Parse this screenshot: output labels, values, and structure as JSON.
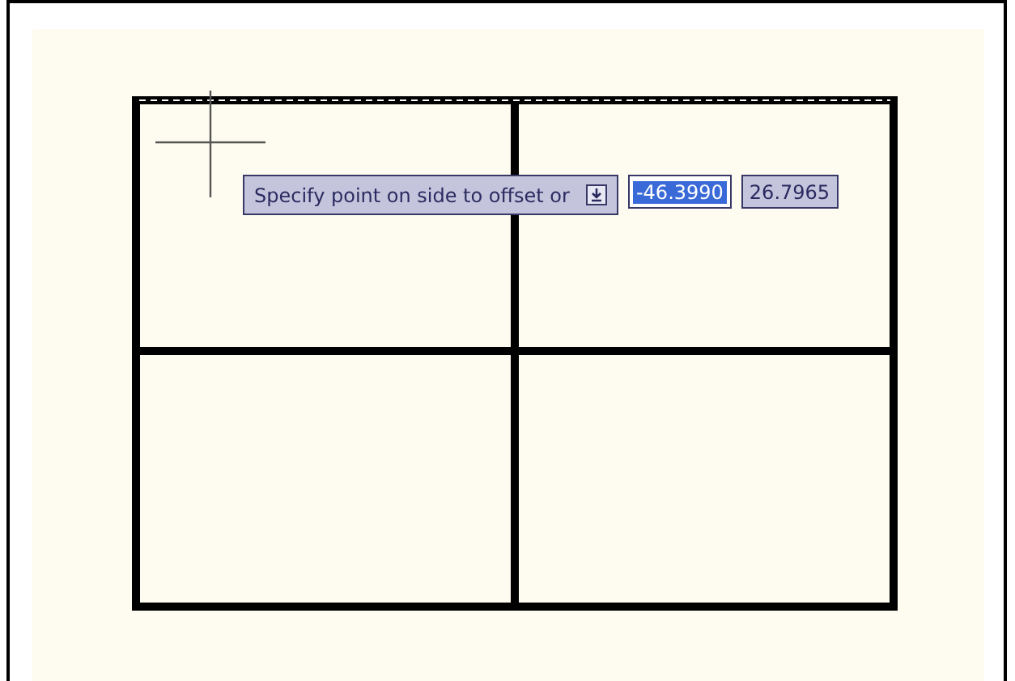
{
  "dynamic_input": {
    "prompt": "Specify point on side to offset or",
    "x_value": {
      "text": "-46.3990",
      "selected": true
    },
    "y_value": {
      "text": "26.7965",
      "selected": false
    }
  }
}
